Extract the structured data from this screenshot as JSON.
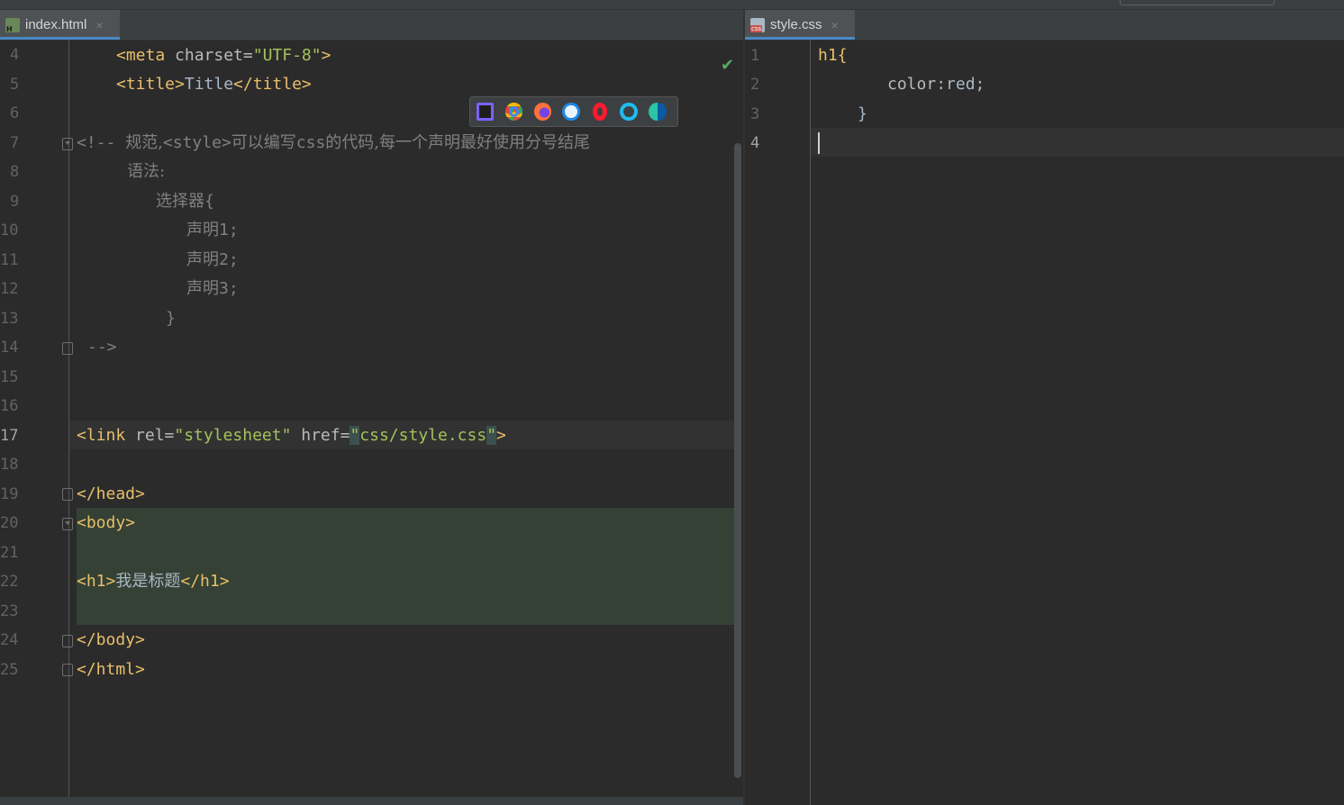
{
  "left_tab": {
    "filename": "index.html",
    "close": "×",
    "icon": "html-file-icon"
  },
  "right_tab": {
    "filename": "style.css",
    "close": "×",
    "icon": "css-file-icon"
  },
  "left_editor": {
    "line_numbers": [
      "4",
      "5",
      "6",
      "7",
      "8",
      "9",
      "10",
      "11",
      "12",
      "13",
      "14",
      "15",
      "16",
      "17",
      "18",
      "19",
      "20",
      "21",
      "22",
      "23",
      "24",
      "25"
    ],
    "current_line": "17",
    "lines": {
      "l4": {
        "open": "<meta",
        "attr": " charset=",
        "val": "\"UTF-8\"",
        "close": ">"
      },
      "l5": {
        "open": "<title>",
        "text": "Title",
        "close": "</title>"
      },
      "l7": {
        "a": "<!-- ",
        "b": "规范,",
        "c": "<style>",
        "d": "可以编写",
        "e": "css",
        "f": "的代码,每一个声明最好使用分号结尾"
      },
      "l8": "语法:",
      "l9a": "选择器",
      "l9b": "{",
      "l10a": "声明",
      "l10b": "1;",
      "l11a": "声明",
      "l11b": "2;",
      "l12a": "声明",
      "l12b": "3;",
      "l13": "}",
      "l14": "-->",
      "l17": {
        "open": "<link",
        "a1": " rel=",
        "v1": "\"stylesheet\"",
        "a2": " href=",
        "q1": "\"",
        "v2": "css/style.css",
        "q2": "\"",
        "close": ">"
      },
      "l19": "</head>",
      "l20": "<body>",
      "l22": {
        "open": "<h1>",
        "text": "我是标题",
        "close": "</h1>"
      },
      "l24": "</body>",
      "l25": "</html>"
    }
  },
  "right_editor": {
    "line_numbers": [
      "1",
      "2",
      "3",
      "4"
    ],
    "current_line": "4",
    "lines": {
      "l1": "h1{",
      "l2a": "color",
      "l2b": ":red;",
      "l3": "}"
    }
  },
  "browser_icons": [
    "intellij-icon",
    "chrome-icon",
    "firefox-icon",
    "safari-icon",
    "opera-icon",
    "ie-icon",
    "edge-icon"
  ],
  "colors": {
    "tag": "#e8bf6a",
    "attr": "#bababa",
    "value": "#a5c25c",
    "comment": "#808080",
    "bg": "#2b2b2b"
  }
}
